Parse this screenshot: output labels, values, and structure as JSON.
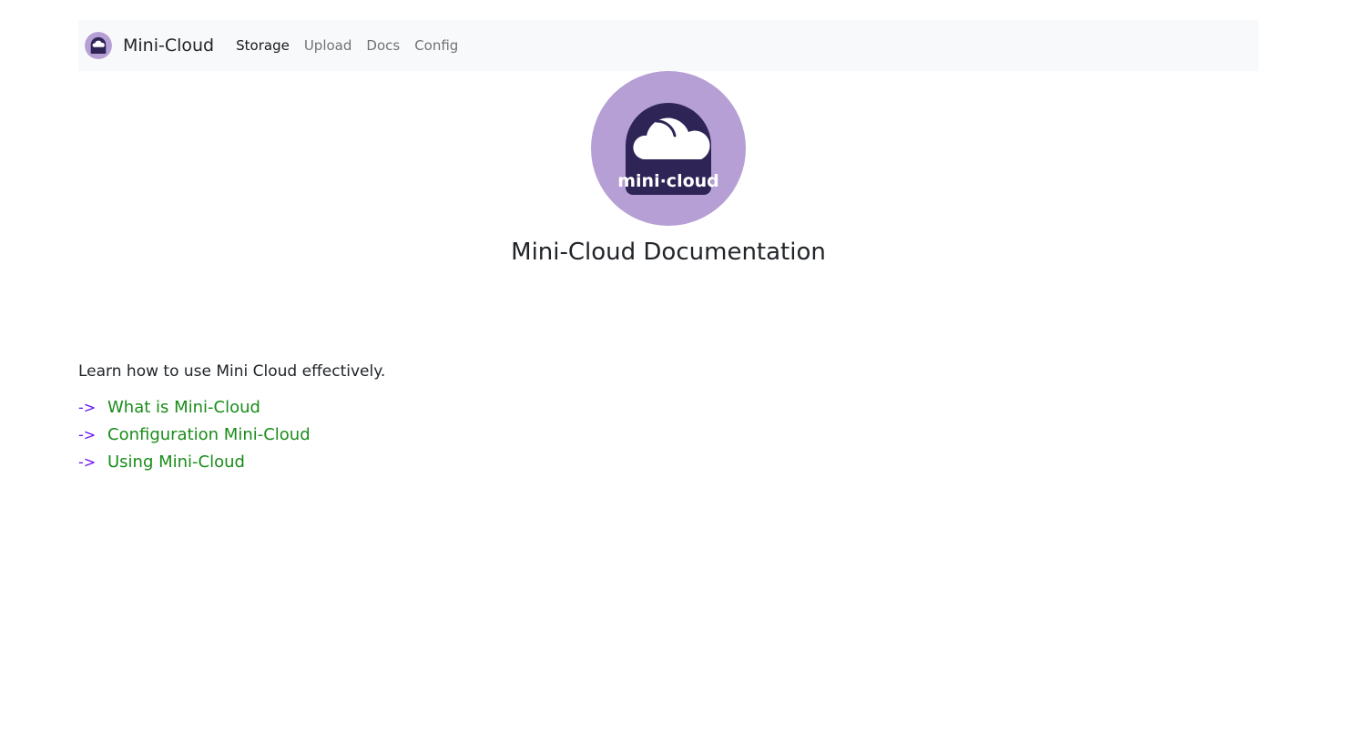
{
  "navbar": {
    "brand_name": "Mini-Cloud",
    "logo_icon": "mini-cloud-logo-icon",
    "links": [
      {
        "label": "Storage",
        "active": true
      },
      {
        "label": "Upload",
        "active": false
      },
      {
        "label": "Docs",
        "active": false
      },
      {
        "label": "Config",
        "active": false
      }
    ]
  },
  "hero": {
    "logo_text": "mini·cloud",
    "title": "Mini-Cloud Documentation"
  },
  "content": {
    "intro": "Learn how to use Mini Cloud effectively.",
    "arrow": "->",
    "links": [
      "What is Mini-Cloud",
      "Configuration Mini-Cloud",
      "Using Mini-Cloud"
    ]
  },
  "colors": {
    "logo_circle": "#b59fd5",
    "logo_dark": "#2e2456",
    "arrow": "#6610f2",
    "link": "#198c19",
    "navbar_bg": "#f8f9fa"
  }
}
